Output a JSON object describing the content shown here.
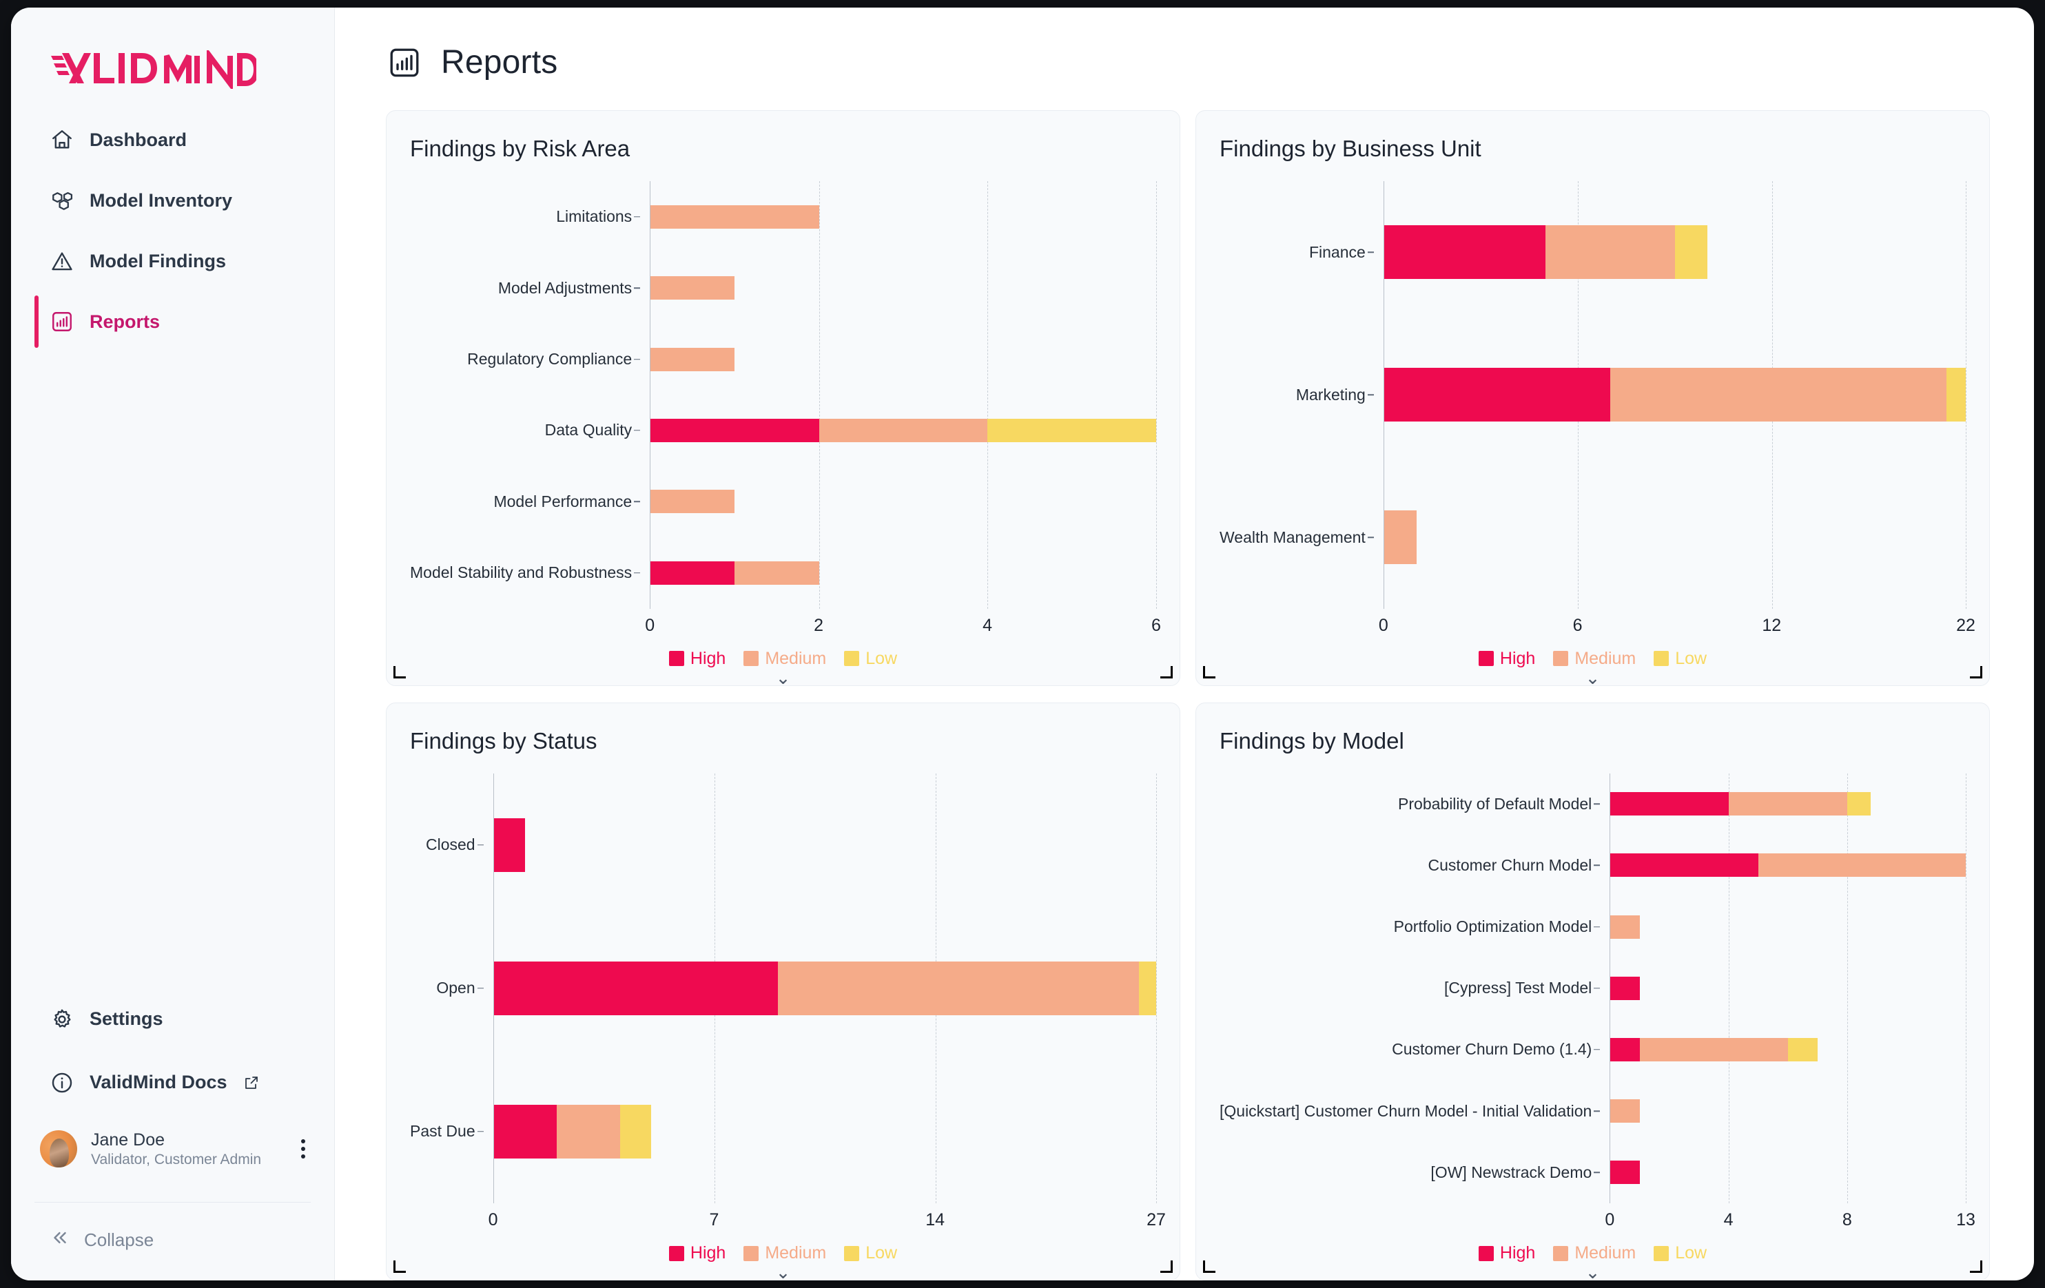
{
  "brand": {
    "name_bold": "VALID",
    "name_light": "MIND",
    "color": "#e51e63"
  },
  "sidebar": {
    "items": [
      {
        "label": "Dashboard",
        "icon": "home-icon",
        "active": false
      },
      {
        "label": "Model Inventory",
        "icon": "cubes-icon",
        "active": false
      },
      {
        "label": "Model Findings",
        "icon": "warning-triangle-icon",
        "active": false
      },
      {
        "label": "Reports",
        "icon": "bar-chart-icon",
        "active": true
      }
    ],
    "bottom_items": [
      {
        "label": "Settings",
        "icon": "gear-icon"
      },
      {
        "label": "ValidMind Docs",
        "icon": "info-circle-icon",
        "external": true
      }
    ],
    "user": {
      "name": "Jane Doe",
      "role": "Validator, Customer Admin"
    },
    "collapse_label": "Collapse"
  },
  "header": {
    "title": "Reports",
    "icon": "bar-chart-icon"
  },
  "legend": [
    {
      "label": "High",
      "color": "#ee0a4f"
    },
    {
      "label": "Medium",
      "color": "#f5ab89"
    },
    {
      "label": "Low",
      "color": "#f7d861"
    }
  ],
  "chart_data": [
    {
      "type": "bar",
      "orientation": "horizontal",
      "stacked": true,
      "title": "Findings by Risk Area",
      "xlabel": "",
      "ylabel": "",
      "grid": true,
      "legend_position": "bottom",
      "ticks": [
        0,
        2,
        4,
        6
      ],
      "xlim": [
        0,
        6
      ],
      "categories": [
        "Limitations",
        "Model Adjustments",
        "Regulatory Compliance",
        "Data Quality",
        "Model Performance",
        "Model Stability and Robustness"
      ],
      "series": [
        {
          "name": "High",
          "color": "#ee0a4f",
          "values": [
            0,
            0,
            0,
            2,
            0,
            1
          ]
        },
        {
          "name": "Medium",
          "color": "#f5ab89",
          "values": [
            2,
            1,
            1,
            2,
            1,
            1
          ]
        },
        {
          "name": "Low",
          "color": "#f7d861",
          "values": [
            0,
            0,
            0,
            2,
            0,
            0
          ]
        }
      ]
    },
    {
      "type": "bar",
      "orientation": "horizontal",
      "stacked": true,
      "title": "Findings by Business Unit",
      "xlabel": "",
      "ylabel": "",
      "grid": true,
      "legend_position": "bottom",
      "ticks": [
        0,
        6,
        12,
        22
      ],
      "xlim": [
        0,
        22
      ],
      "categories": [
        "Finance",
        "Marketing",
        "Wealth Management"
      ],
      "series": [
        {
          "name": "High",
          "color": "#ee0a4f",
          "values": [
            5,
            7,
            0
          ]
        },
        {
          "name": "Medium",
          "color": "#f5ab89",
          "values": [
            4,
            14,
            1
          ]
        },
        {
          "name": "Low",
          "color": "#f7d861",
          "values": [
            1,
            1,
            0
          ]
        }
      ]
    },
    {
      "type": "bar",
      "orientation": "horizontal",
      "stacked": true,
      "title": "Findings by Status",
      "xlabel": "",
      "ylabel": "",
      "grid": true,
      "legend_position": "bottom",
      "ticks": [
        0,
        7,
        14,
        27
      ],
      "xlim": [
        0,
        27
      ],
      "categories": [
        "Closed",
        "Open",
        "Past Due"
      ],
      "series": [
        {
          "name": "High",
          "color": "#ee0a4f",
          "values": [
            1,
            9,
            2
          ]
        },
        {
          "name": "Medium",
          "color": "#f5ab89",
          "values": [
            0,
            17,
            2
          ]
        },
        {
          "name": "Low",
          "color": "#f7d861",
          "values": [
            0,
            1,
            1
          ]
        }
      ]
    },
    {
      "type": "bar",
      "orientation": "horizontal",
      "stacked": true,
      "title": "Findings by Model",
      "xlabel": "",
      "ylabel": "",
      "grid": true,
      "legend_position": "bottom",
      "ticks": [
        0,
        4,
        8,
        13
      ],
      "xlim": [
        0,
        13
      ],
      "categories": [
        "Probability of Default Model",
        "Customer Churn Model",
        "Portfolio Optimization Model",
        "[Cypress] Test Model",
        "Customer Churn Demo (1.4)",
        "[Quickstart] Customer Churn Model - Initial Validation",
        "[OW] Newstrack Demo"
      ],
      "series": [
        {
          "name": "High",
          "color": "#ee0a4f",
          "values": [
            4,
            5,
            0,
            1,
            1,
            0,
            1
          ]
        },
        {
          "name": "Medium",
          "color": "#f5ab89",
          "values": [
            4,
            8,
            1,
            0,
            5,
            1,
            0
          ]
        },
        {
          "name": "Low",
          "color": "#f7d861",
          "values": [
            1,
            0,
            0,
            0,
            1,
            0,
            0
          ]
        }
      ]
    }
  ]
}
